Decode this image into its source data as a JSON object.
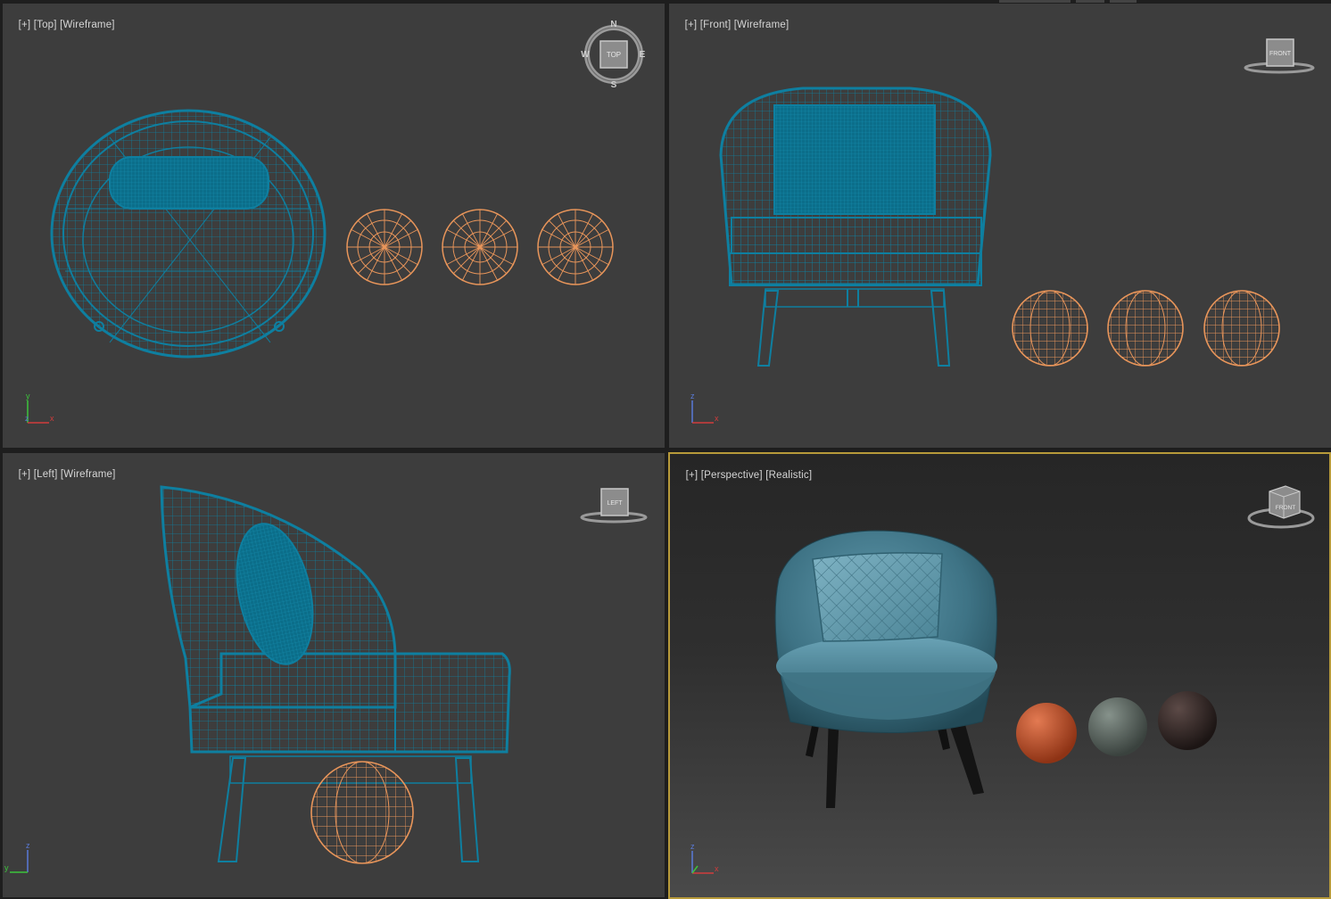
{
  "viewports": {
    "top": {
      "plus": "[+]",
      "view": "[Top]",
      "shading": "[Wireframe]"
    },
    "front": {
      "plus": "[+]",
      "view": "[Front]",
      "shading": "[Wireframe]"
    },
    "left": {
      "plus": "[+]",
      "view": "[Left]",
      "shading": "[Wireframe]"
    },
    "perspective": {
      "plus": "[+]",
      "view": "[Perspective]",
      "shading": "[Realistic]"
    }
  },
  "viewcube": {
    "top_face": "TOP",
    "front_face": "FRONT",
    "left_face": "LEFT",
    "compass": {
      "n": "N",
      "s": "S",
      "e": "E",
      "w": "W"
    }
  },
  "axes": {
    "x": "x",
    "y": "y",
    "z": "z"
  },
  "colors": {
    "viewport_bg": "#3d3d3d",
    "active_border": "#b79a3a",
    "chair_wire": "#0e7fa0",
    "sphere_wire": "#e8955a",
    "chair_fabric": "#3e7385",
    "leg": "#141414",
    "sphere_orange": "#c9512c",
    "sphere_grey_green": "#5f6a63",
    "sphere_dark_brown": "#3a2e2c"
  },
  "icons": [
    "viewcube-icon",
    "compass-ring-icon",
    "axis-tripod-icon"
  ]
}
